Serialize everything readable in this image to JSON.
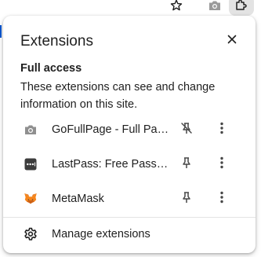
{
  "toolbar": {
    "icons": [
      "star-icon",
      "camera-icon",
      "puzzle-icon"
    ]
  },
  "popup": {
    "title": "Extensions",
    "close_icon": "close-icon",
    "section": {
      "heading": "Full access",
      "description": "These extensions can see and change information on this site."
    },
    "extensions": [
      {
        "name": "GoFullPage - Full Page Screen Capture",
        "icon": "camera-icon",
        "pinned": false,
        "pin_icon": "pin-off-icon"
      },
      {
        "name": "LastPass: Free Password Manager",
        "icon": "lastpass-icon",
        "pinned": true,
        "pin_icon": "pin-icon"
      },
      {
        "name": "MetaMask",
        "icon": "metamask-fox-icon",
        "pinned": true,
        "pin_icon": "pin-icon"
      }
    ],
    "manage": {
      "label": "Manage extensions",
      "icon": "gear-icon"
    }
  },
  "colors": {
    "text": "#1f1f1f",
    "icon_gray": "#474747",
    "active_button_bg": "#e3e3e3",
    "focus_accent": "#0b57d0",
    "lastpass_red": "#3c3c3c",
    "metamask_orange": "#e2761b"
  }
}
